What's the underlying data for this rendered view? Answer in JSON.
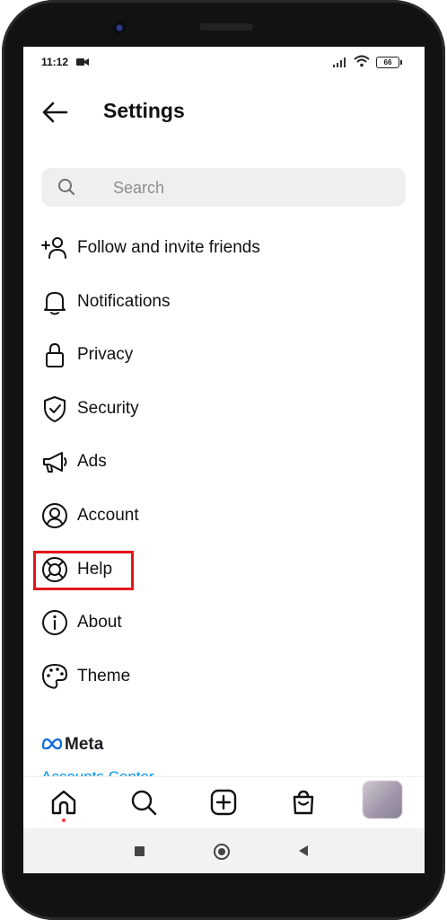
{
  "status_bar": {
    "time": "11:12",
    "battery": "66"
  },
  "header": {
    "title": "Settings"
  },
  "search": {
    "placeholder": "Search"
  },
  "menu": {
    "items": [
      {
        "label": "Follow and invite friends",
        "icon": "add-person-icon"
      },
      {
        "label": "Notifications",
        "icon": "bell-icon"
      },
      {
        "label": "Privacy",
        "icon": "lock-icon"
      },
      {
        "label": "Security",
        "icon": "shield-check-icon"
      },
      {
        "label": "Ads",
        "icon": "megaphone-icon"
      },
      {
        "label": "Account",
        "icon": "account-circle-icon"
      },
      {
        "label": "Help",
        "icon": "lifebuoy-icon"
      },
      {
        "label": "About",
        "icon": "info-icon"
      },
      {
        "label": "Theme",
        "icon": "palette-icon"
      }
    ]
  },
  "meta": {
    "brand": "Meta",
    "accounts_center": "Accounts Center"
  },
  "colors": {
    "highlight": "#e3151a",
    "meta_blue": "#0095f6",
    "notification_dot": "#ff3040"
  }
}
